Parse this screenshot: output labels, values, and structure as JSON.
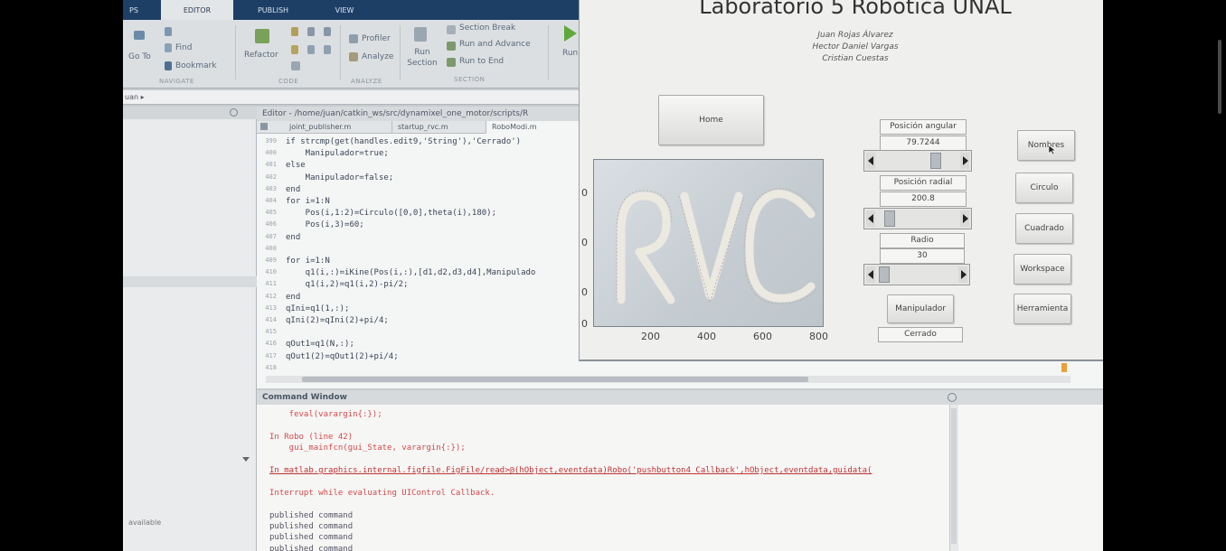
{
  "ribbon": {
    "tabs": [
      "PS",
      "EDITOR",
      "PUBLISH",
      "VIEW"
    ],
    "navigate": {
      "go_to": "Go To",
      "find": "Find",
      "bookmark": "Bookmark",
      "section_label": "NAVIGATE"
    },
    "code": {
      "refactor": "Refactor",
      "section_label": "CODE"
    },
    "analyze": {
      "profiler": "Profiler",
      "analyze": "Analyze",
      "section_label": "ANALYZE"
    },
    "section": {
      "run_section": "Run Section",
      "section_break": "Section Break",
      "run_and_advance": "Run and Advance",
      "run_to_end": "Run to End",
      "section_label": "SECTION"
    },
    "run": "Run"
  },
  "path_bar": "uan ▸",
  "left_panel": {
    "footer_text": "available"
  },
  "editor": {
    "title": "Editor - /home/juan/catkin_ws/src/dynamixel_one_motor/scripts/R",
    "tabs": [
      "joint_publisher.m",
      "startup_rvc.m",
      "RoboModi.m"
    ],
    "line_numbers": [
      "399",
      "400",
      "401",
      "402",
      "403",
      "404",
      "405",
      "406",
      "407",
      "408",
      "409",
      "410",
      "411",
      "412",
      "413",
      "414",
      "415",
      "416",
      "417",
      "418"
    ],
    "code_lines": [
      "if strcmp(get(handles.edit9,'String'),'Cerrado')",
      "    Manipulador=true;",
      "else",
      "    Manipulador=false;",
      "end",
      "for i=1:N",
      "    Pos(i,1:2)=Circulo([0,0],theta(i),180);",
      "    Pos(i,3)=60;",
      "end",
      "",
      "for i=1:N",
      "    q1(i,:)=iKine(Pos(i,:),[d1,d2,d3,d4],Manipulado",
      "    q1(i,2)=q1(i,2)-pi/2;",
      "end",
      "qIni=q1(1,:);",
      "qIni(2)=qIni(2)+pi/4;",
      "",
      "qOut1=q1(N,:);",
      "qOut1(2)=qOut1(2)+pi/4;",
      ""
    ]
  },
  "command_window": {
    "title": "Command Window",
    "lines": [
      {
        "text": "    feval(varargin{:});",
        "kind": "err"
      },
      {
        "text": "",
        "kind": "txt"
      },
      {
        "text": "In Robo (line 42)",
        "kind": "err"
      },
      {
        "text": "    gui_mainfcn(gui_State, varargin{:});",
        "kind": "err"
      },
      {
        "text": "",
        "kind": "txt"
      },
      {
        "text": "In matlab.graphics.internal.figfile.FigFile/read>@(hObject,eventdata)Robo('pushbutton4_Callback',hObject,eventdata,guidata(",
        "kind": "errlink"
      },
      {
        "text": "",
        "kind": "txt"
      },
      {
        "text": "Interrupt while evaluating UIControl Callback.",
        "kind": "err"
      },
      {
        "text": "",
        "kind": "txt"
      },
      {
        "text": "published command",
        "kind": "txt"
      },
      {
        "text": "published command",
        "kind": "txt"
      },
      {
        "text": "published command",
        "kind": "txt"
      },
      {
        "text": "published command",
        "kind": "txt"
      }
    ]
  },
  "gui": {
    "title": "Laboratorio 5 Robótica UNAL",
    "authors": [
      "Juan Rojas Álvarez",
      "Hector Daniel Vargas",
      "Cristian Cuestas"
    ],
    "home_button": "Home",
    "plot": {
      "artwork_text": "RVC",
      "x_ticks": [
        "200",
        "400",
        "600",
        "800"
      ],
      "y_ticks": [
        "0",
        "0",
        "0",
        "0"
      ]
    },
    "controls": {
      "angular_label": "Posición angular",
      "angular_value": "79.7244",
      "angular_slider_fraction": 0.78,
      "radial_label": "Posición radial",
      "radial_value": "200.8",
      "radial_slider_fraction": 0.1,
      "radio_label": "Radio",
      "radio_value": "30",
      "radio_slider_fraction": 0.03,
      "manipulador_button": "Manipulador",
      "manipulador_state": "Cerrado"
    },
    "side_buttons": [
      "Nombres",
      "Circulo",
      "Cuadrado",
      "Workspace",
      "Herramienta"
    ]
  },
  "colors": {
    "matlab_tabbar": "#1d3f66",
    "error_text": "#d44a4a",
    "gui_background": "#efefed"
  }
}
